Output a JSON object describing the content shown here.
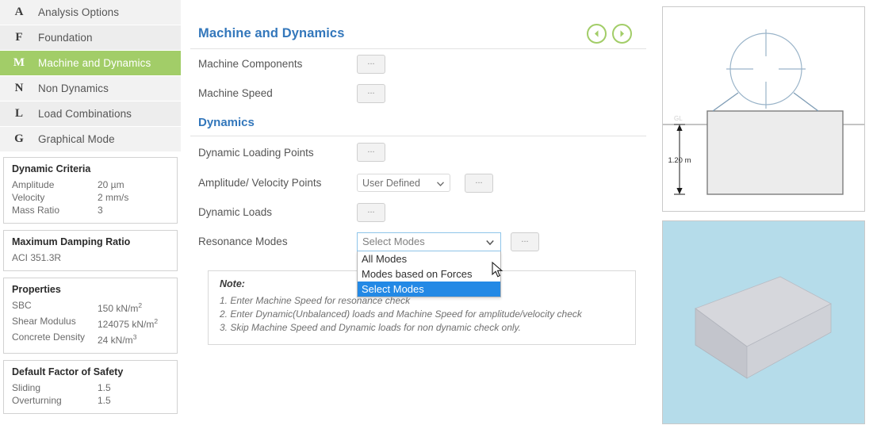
{
  "sidebar": {
    "nav_items": [
      {
        "key": "A",
        "label": "Analysis Options",
        "active": false
      },
      {
        "key": "F",
        "label": "Foundation",
        "active": false
      },
      {
        "key": "M",
        "label": "Machine and Dynamics",
        "active": true
      },
      {
        "key": "N",
        "label": "Non Dynamics",
        "active": false
      },
      {
        "key": "L",
        "label": "Load Combinations",
        "active": false
      },
      {
        "key": "G",
        "label": "Graphical Mode",
        "active": false
      }
    ],
    "cards": [
      {
        "title": "Dynamic Criteria",
        "rows": [
          {
            "k": "Amplitude",
            "v": "20 µm"
          },
          {
            "k": "Velocity",
            "v": "2 mm/s"
          },
          {
            "k": "Mass Ratio",
            "v": "3"
          }
        ]
      },
      {
        "title": "Maximum Damping Ratio",
        "rows": [
          {
            "k": "ACI 351.3R",
            "v": ""
          }
        ]
      },
      {
        "title": "Properties",
        "rows": [
          {
            "k": "SBC",
            "v": "150 kN/m",
            "sup": "2"
          },
          {
            "k": "Shear Modulus",
            "v": "124075 kN/m",
            "sup": "2"
          },
          {
            "k": "Concrete Density",
            "v": "24 kN/m",
            "sup": "3"
          }
        ]
      },
      {
        "title": "Default Factor of Safety",
        "rows": [
          {
            "k": "Sliding",
            "v": "1.5"
          },
          {
            "k": "Overturning",
            "v": "1.5"
          }
        ]
      }
    ]
  },
  "main": {
    "section_title": "Machine and Dynamics",
    "subsection_title": "Dynamics",
    "nav_back_icon": "arrow-left-circle-icon",
    "nav_next_icon": "arrow-right-circle-icon",
    "ellipsis_label": "...",
    "rows_top": [
      {
        "label": "Machine Components"
      },
      {
        "label": "Machine Speed"
      }
    ],
    "rows_dynamics": [
      {
        "label": "Dynamic Loading Points"
      },
      {
        "label": "Dynamic Loads"
      }
    ],
    "amplitude_row": {
      "label": "Amplitude/ Velocity Points",
      "select_value": "User Defined",
      "select_options": [
        "User Defined"
      ]
    },
    "resonance_row": {
      "label": "Resonance Modes",
      "combo_value": "Select Modes",
      "combo_placeholder": "Select Modes",
      "options": [
        {
          "label": "All Modes",
          "selected": false
        },
        {
          "label": "Modes based on Forces",
          "selected": false
        },
        {
          "label": "Select Modes",
          "selected": true
        }
      ]
    },
    "note": {
      "title": "Note:",
      "lines": [
        "1. Enter Machine Speed for resonance check",
        "2. Enter Dynamic(Unbalanced) loads and Machine Speed for amplitude/velocity check",
        "3. Skip Machine Speed and Dynamic loads for non dynamic check only."
      ]
    }
  },
  "views": {
    "elevation": {
      "name": "elevation-view",
      "depth_label": "1.20 m",
      "ground_label": "GL"
    },
    "model3d": {
      "name": "3d-model-view",
      "background": "#b5dcea"
    }
  },
  "colors": {
    "accent_green": "#a2cd68",
    "heading_blue": "#3377bb",
    "highlight_blue": "#2389e5",
    "panel_gray": "#f2f2f2"
  }
}
